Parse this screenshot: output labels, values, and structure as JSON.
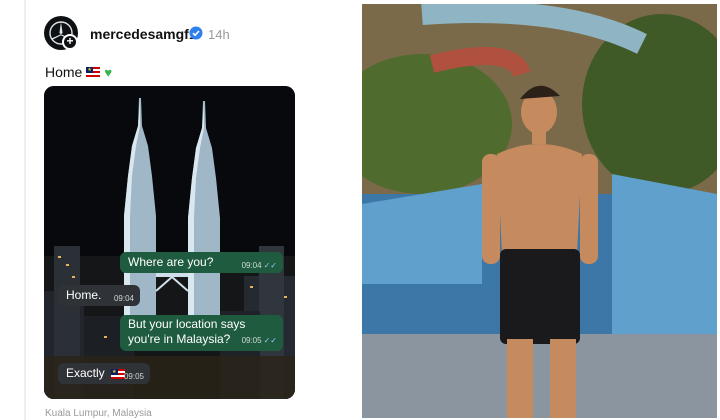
{
  "post": {
    "username": "mercedesamgf1",
    "time": "14h",
    "caption": "Home",
    "location": "Kuala Lumpur, Malaysia"
  },
  "chat": [
    {
      "text": "Where are you?",
      "time": "09:04",
      "direction": "out"
    },
    {
      "text": "Home.",
      "time": "09:04",
      "direction": "in"
    },
    {
      "text_line1": "But your location says",
      "text_line2": "you're in Malaysia?",
      "time": "09:05",
      "direction": "out"
    },
    {
      "text": "Exactly",
      "time": "09:05",
      "direction": "in"
    }
  ],
  "colors": {
    "verified": "#2f80ed",
    "outgoing_bubble": "#1f5c3f",
    "incoming_bubble": "#2f3338",
    "heart": "#37b24d"
  },
  "icons": [
    "mercedes-logo-icon",
    "plus-icon",
    "verified-icon",
    "malaysia-flag-icon",
    "green-heart-icon",
    "read-ticks-icon"
  ]
}
